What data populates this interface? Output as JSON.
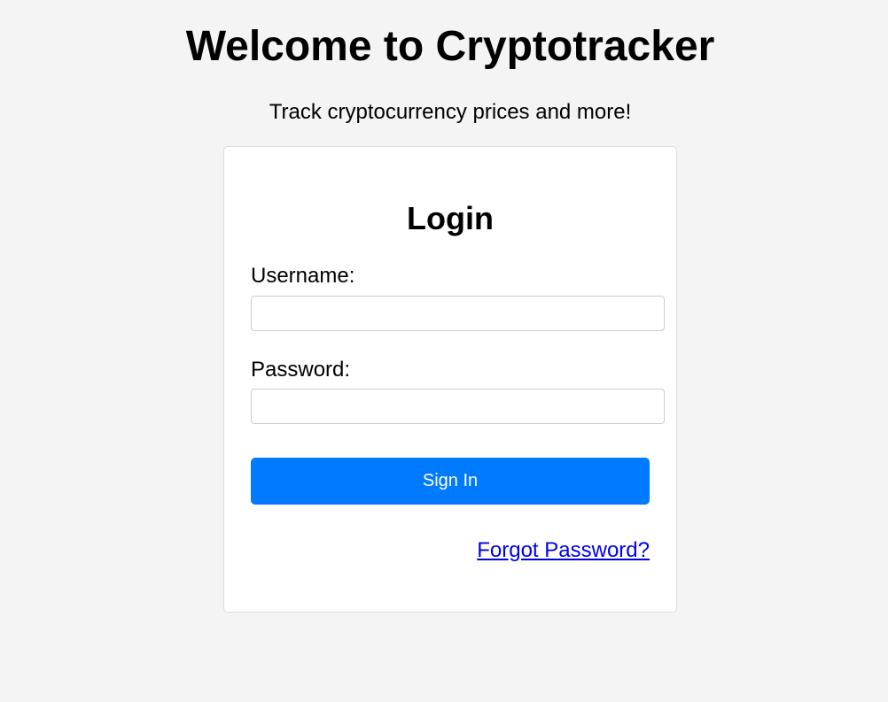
{
  "header": {
    "title": "Welcome to Cryptotracker",
    "subtitle": "Track cryptocurrency prices and more!"
  },
  "login": {
    "heading": "Login",
    "username_label": "Username:",
    "username_value": "",
    "password_label": "Password:",
    "password_value": "",
    "signin_label": "Sign In",
    "forgot_label": "Forgot Password?"
  },
  "colors": {
    "background": "#f4f4f4",
    "card": "#ffffff",
    "primary_button": "#007bff",
    "link": "#0000ee"
  }
}
